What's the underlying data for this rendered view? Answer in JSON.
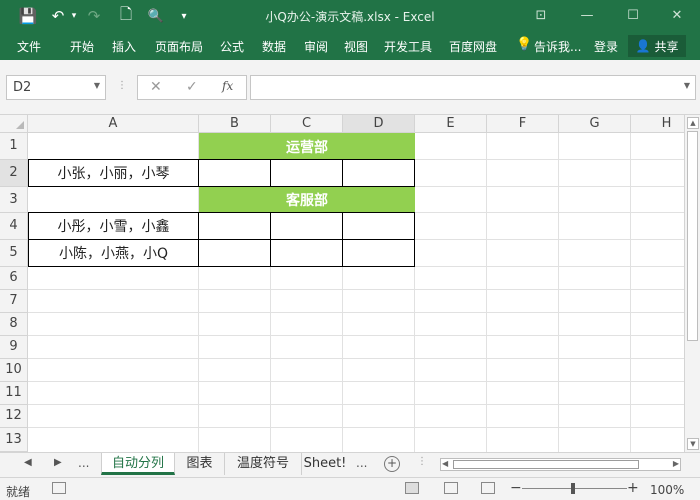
{
  "window": {
    "title": "小Q办公-演示文稿.xlsx  -  Excel",
    "save_icon": "💾",
    "undo_icon": "↶",
    "redo_icon": "↷",
    "new_icon": "🗋",
    "print_preview_icon": "🔍",
    "customize_icon": "▾",
    "ribbon_display_icon": "⊡",
    "minimize_icon": "—",
    "maximize_icon": "☐",
    "close_icon": "✕"
  },
  "ribbon": {
    "tabs": [
      "文件",
      "开始",
      "插入",
      "页面布局",
      "公式",
      "数据",
      "审阅",
      "视图",
      "开发工具",
      "百度网盘"
    ],
    "tell_me": "告诉我...",
    "signin": "登录",
    "share": "共享"
  },
  "formula_bar": {
    "name_box": "D2",
    "cancel_icon": "✕",
    "enter_icon": "✓",
    "fx_icon": "fx",
    "formula": ""
  },
  "sheet": {
    "columns": [
      "A",
      "B",
      "C",
      "D",
      "E",
      "F",
      "G",
      "H"
    ],
    "rows": [
      "1",
      "2",
      "3",
      "4",
      "5",
      "6",
      "7",
      "8",
      "9",
      "10",
      "11",
      "12",
      "13"
    ],
    "cells": {
      "B1": "运营部",
      "A2": "小张，小丽，小琴",
      "B3": "客服部",
      "A4": "小彤，小雪，小鑫",
      "A5": "小陈，小燕，小Q"
    },
    "header_fill": "#92d050",
    "selected_cell": "D2"
  },
  "sheet_tabs": {
    "more": "...",
    "tabs": [
      "自动分列",
      "图表",
      "温度符号",
      "Sheet!"
    ],
    "overflow": "...",
    "active": 0
  },
  "status": {
    "ready": "就绪",
    "zoom": "100%"
  },
  "colors": {
    "accent": "#217346"
  }
}
